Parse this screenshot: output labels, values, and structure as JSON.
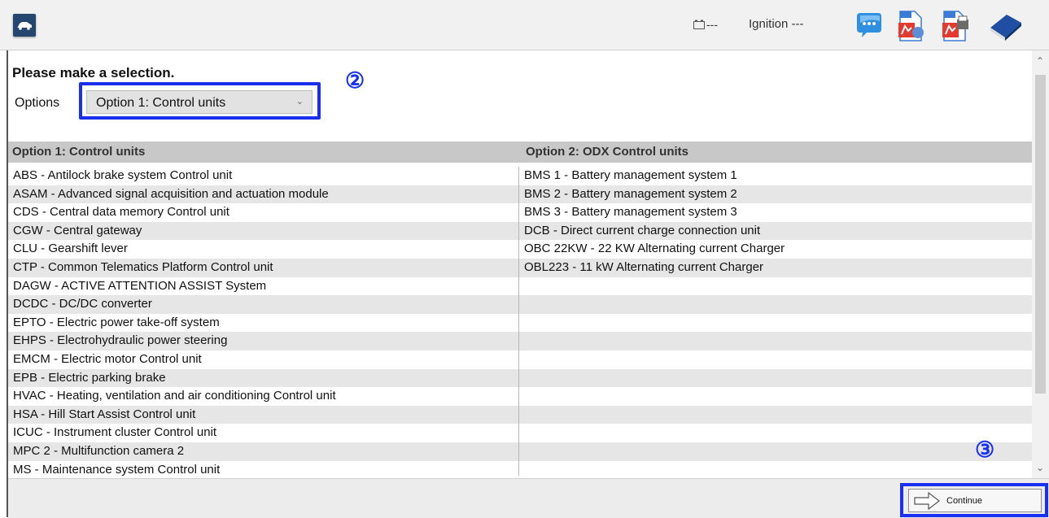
{
  "status": {
    "battery": "---",
    "ignition": "Ignition ---"
  },
  "toolbar": {
    "icons": [
      "car-icon",
      "battery-icon",
      "chat-icon",
      "pdf-export-icon",
      "pdf-print-icon",
      "help-book-icon"
    ]
  },
  "heading": "Please make a selection.",
  "options": {
    "label": "Options",
    "selected": "Option 1: Control units"
  },
  "markers": {
    "select": "②",
    "continue": "③"
  },
  "table": {
    "headers": [
      "Option 1: Control units",
      "Option 2: ODX Control units"
    ],
    "col1": [
      "ABS - Antilock brake system Control unit",
      "ASAM - Advanced signal acquisition and actuation module",
      "CDS - Central data memory Control unit",
      "CGW - Central gateway",
      "CLU - Gearshift lever",
      "CTP - Common Telematics Platform Control unit",
      "DAGW - ACTIVE ATTENTION ASSIST System",
      "DCDC - DC/DC converter",
      "EPTO - Electric power take-off system",
      "EHPS - Electrohydraulic power steering",
      "EMCM - Electric motor Control unit",
      "EPB - Electric parking brake",
      "HVAC - Heating, ventilation and air conditioning Control unit",
      "HSA - Hill Start Assist Control unit",
      "ICUC - Instrument cluster Control unit",
      "MPC 2 - Multifunction camera 2",
      "MS - Maintenance system Control unit"
    ],
    "col2": [
      "BMS 1 - Battery management system 1",
      "BMS 2 - Battery management system 2",
      "BMS 3 - Battery management system 3",
      "DCB - Direct current charge connection unit",
      "OBC 22KW - 22 KW Alternating current Charger",
      "OBL223 - 11 kW Alternating current Charger"
    ]
  },
  "continue_label": "Continue",
  "colors": {
    "highlight": "#1a2ff0",
    "header_bg": "#c8c8c8",
    "stripe": "#e6e6e6",
    "car_button": "#24466f"
  }
}
